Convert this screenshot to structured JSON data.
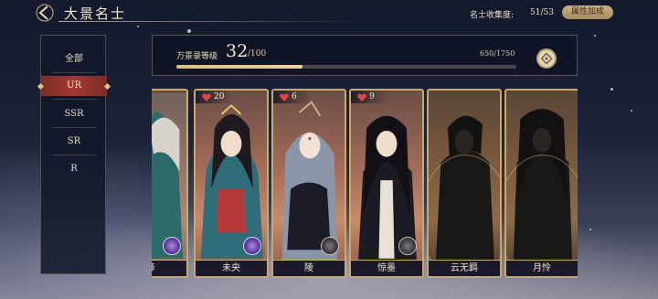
{
  "header": {
    "title": "大景名士",
    "collection_label": "名士收集度:",
    "collection_value": "51/53",
    "attr_button": "属性加成"
  },
  "sidebar": {
    "items": [
      {
        "label": "全部",
        "active": false
      },
      {
        "label": "UR",
        "active": true
      },
      {
        "label": "SSR",
        "active": false
      },
      {
        "label": "SR",
        "active": false
      },
      {
        "label": "R",
        "active": false
      }
    ]
  },
  "level": {
    "label": "万景录等级",
    "current": "32",
    "max": "/100",
    "exp_text": "650/1750",
    "exp_progress": 0.371
  },
  "cards": [
    {
      "name": "泽",
      "hearts": "",
      "badge": "purple",
      "locked": false
    },
    {
      "name": "未央",
      "hearts": "20",
      "badge": "purple",
      "locked": false
    },
    {
      "name": "陵",
      "hearts": "6",
      "badge": "dark",
      "locked": false
    },
    {
      "name": "惊墨",
      "hearts": "9",
      "badge": "dark",
      "locked": false
    },
    {
      "name": "云无羁",
      "hearts": "",
      "badge": "",
      "locked": true
    },
    {
      "name": "月怜",
      "hearts": "",
      "badge": "",
      "locked": true
    }
  ],
  "colors": {
    "accent_gold": "#c9a96a",
    "active_tab": "#a23a32",
    "heart": "#e0434a"
  }
}
